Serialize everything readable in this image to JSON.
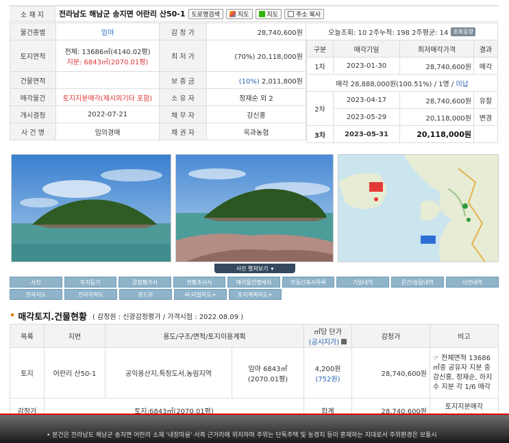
{
  "address": {
    "label": "소 재 지",
    "value": "전라남도 해남군 송지면 어란리 산50-1",
    "buttons": [
      "도로명검색",
      "지도",
      "지도",
      "주소 복사"
    ]
  },
  "info": {
    "r1": {
      "l1": "물건종별",
      "v1": "임야",
      "l2": "감 정 가",
      "v2": "28,740,600원"
    },
    "r2": {
      "l1": "토지면적",
      "v1a": "전체: 13686㎡(4140.02평)",
      "v1b": "지분: 6843㎡(2070.01평)",
      "l2": "최 저 가",
      "v2": "(70%) 20,118,000원"
    },
    "r3": {
      "l1": "건물면적",
      "v1": "",
      "l2": "보 증 금",
      "v2a": "(10%)",
      "v2b": " 2,011,800원"
    },
    "r4": {
      "l1": "매각물건",
      "v1": "토지지분매각(제시외기타 포함)",
      "l2": "소 유 자",
      "v2": "정재순 외 2"
    },
    "r5": {
      "l1": "개시결정",
      "v1": "2022-07-21",
      "l2": "채 무 자",
      "v2": "강신홍"
    },
    "r6": {
      "l1": "사 건 명",
      "v1": "임의경매",
      "l2": "채 권 자",
      "v2": "옥과농협"
    }
  },
  "views": {
    "text": "오늘조회: 10  2주누적: 198  2주평균: 14",
    "button": "조회동향"
  },
  "schedule": {
    "headers": [
      "구분",
      "매각기일",
      "최저매각가격",
      "결과"
    ],
    "r1": {
      "round": "1차",
      "date": "2023-01-30",
      "price": "28,740,600원",
      "result": "매각"
    },
    "sale_note_a": "매각 28,888,000원(100.51%) / 1명 / ",
    "sale_note_b": "미납",
    "r2": {
      "round": "2차",
      "date": "2023-04-17",
      "price": "28,740,600원",
      "result": "유찰"
    },
    "r2b": {
      "date": "2023-05-29",
      "price": "20,118,000원",
      "result": "변경"
    },
    "r3": {
      "round": "3차",
      "date": "2023-05-31",
      "price": "20,118,000원",
      "result": ""
    }
  },
  "photo_toggle": "사진 펼쳐보기",
  "tabs_row1": [
    "사진",
    "토지등기",
    "감정평가서",
    "현황조사서",
    "매각물건명세서",
    "부동산표시목록",
    "기일내역",
    "문건/송달내역",
    "사건내역"
  ],
  "tabs_row2": [
    "전자지도",
    "전자지적도",
    "로드뷰",
    "씨:리얼지도+",
    "토지계획지도+"
  ],
  "section": {
    "title": "매각토지.건물현황",
    "sub": "( 감정원 : 신광감정평가 / 가격시점 : 2022.08.09 )"
  },
  "land": {
    "headers": {
      "h1": "목록",
      "h2": "지번",
      "h3": "용도/구조/면적/토지이용계획",
      "h4a": "㎡당 단가",
      "h4b": "(공시지가)",
      "h5": "감정가",
      "h6": "비고"
    },
    "row": {
      "c1": "토지",
      "c2": "어란리 산50-1",
      "c3": "공익용산지,특정도서,농림지역",
      "c4a": "임야 6843㎡",
      "c4b": "(2070.01평)",
      "c5a": "4,200원",
      "c5b": "(752원)",
      "c6": "28,740,600원",
      "c7": "☞ 전체면적 13686㎡중 공유자 지분 중 강신홍, 정재순, 하지수 지분 각 1/6 매각"
    },
    "total": {
      "c1": "감정가",
      "c2": "토지:6843㎡(2070.01평)",
      "c3": "합계",
      "c4": "28,740,600원",
      "c5a": "토지지분매각",
      "c5b": "(제시외기타 포함)"
    }
  },
  "footnote": "• 본건은 전라남도 해남군 송지면 어란리 소재 '내장마을' 서측 근거리에 위치하며 주위는 단독주택 및 농경지 등이 혼재하는 지대로서 주위환경은 보통시"
}
